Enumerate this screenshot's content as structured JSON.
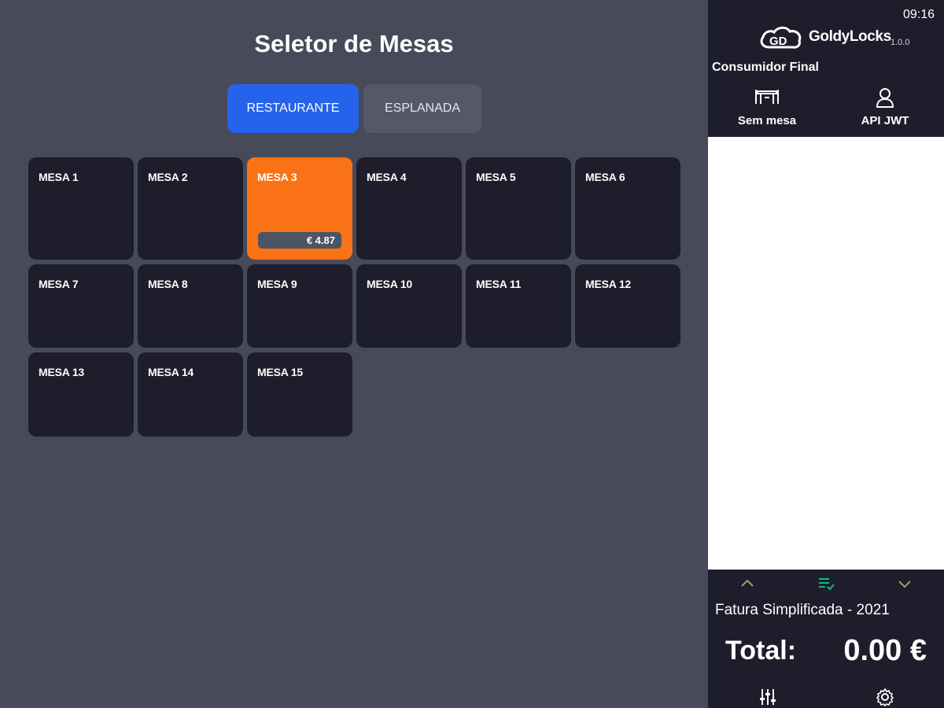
{
  "main": {
    "title": "Seletor de Mesas",
    "tabs": [
      {
        "label": "RESTAURANTE",
        "active": true
      },
      {
        "label": "ESPLANADA",
        "active": false
      }
    ],
    "tables": [
      {
        "label": "MESA 1"
      },
      {
        "label": "MESA 2"
      },
      {
        "label": "MESA 3",
        "amount": "€ 4.87",
        "active": true
      },
      {
        "label": "MESA 4"
      },
      {
        "label": "MESA 5"
      },
      {
        "label": "MESA 6"
      },
      {
        "label": "MESA 7"
      },
      {
        "label": "MESA 8"
      },
      {
        "label": "MESA 9"
      },
      {
        "label": "MESA 10"
      },
      {
        "label": "MESA 11"
      },
      {
        "label": "MESA 12"
      },
      {
        "label": "MESA 13"
      },
      {
        "label": "MESA 14"
      },
      {
        "label": "MESA 15"
      }
    ]
  },
  "sidebar": {
    "time": "09:16",
    "brand": "GoldyLocks",
    "version": "1.0.0",
    "customer": "Consumidor Final",
    "actions": [
      {
        "label": "Sem mesa",
        "icon": "table-icon"
      },
      {
        "label": "API JWT",
        "icon": "user-icon"
      }
    ],
    "document_type": "Fatura Simplificada - 2021",
    "total_label": "Total:",
    "total_value": "0.00 €"
  },
  "colors": {
    "background": "#474a59",
    "card": "#1e1d2b",
    "active_card": "#f97316",
    "tab_active": "#2563eb",
    "tab_inactive": "#555868",
    "nav_accent": "#10b981",
    "nav_arrow": "#a3a06a"
  }
}
